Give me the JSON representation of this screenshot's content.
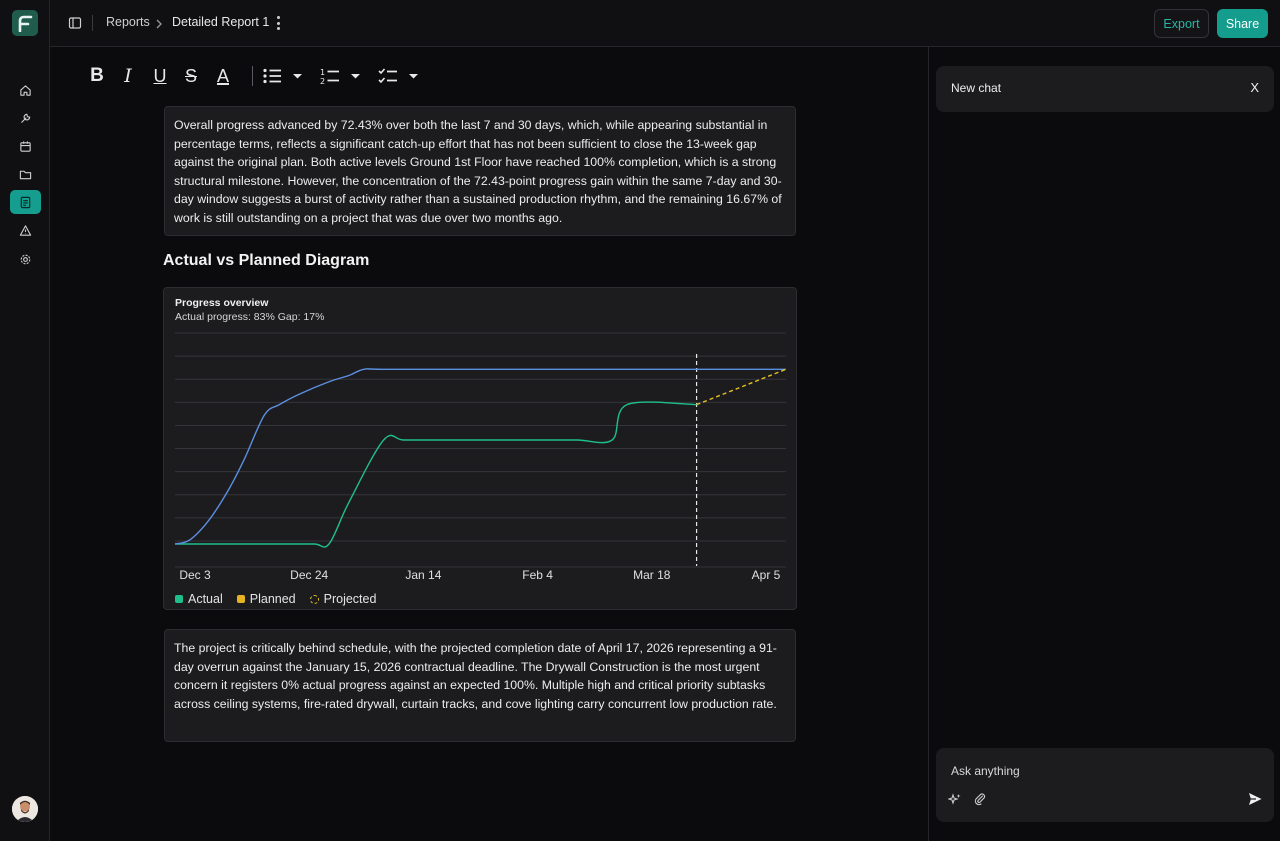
{
  "header": {
    "breadcrumb_root": "Reports",
    "breadcrumb_current": "Detailed Report 1",
    "export_label": "Export",
    "share_label": "Share"
  },
  "toolbar": {
    "bold": "B",
    "italic": "I",
    "underline": "U",
    "strike": "S",
    "text_color": "A"
  },
  "document": {
    "summary_paragraph": "Overall progress advanced by 72.43% over both the last 7 and 30 days, which, while appearing substantial in percentage terms, reflects a significant catch-up effort that has not been sufficient to close the 13-week gap against the original plan. Both active levels Ground 1st Floor have reached 100% completion, which is a strong structural milestone. However, the concentration of the 72.43-point progress gain within the same 7-day and 30-day window suggests a burst of activity rather than a sustained production rhythm, and the remaining 16.67% of work is still outstanding on a project that was due over two months ago.",
    "section_title": "Actual vs Planned Diagram",
    "bottom_paragraph": "The project is critically behind schedule, with the projected completion date of April 17, 2026 representing a 91-day overrun against the January 15, 2026 contractual deadline. The Drywall Construction is the most urgent concern it registers 0% actual progress against an expected 100%. Multiple high and critical priority subtasks across ceiling systems, fire-rated drywall, curtain tracks, and cove lighting carry concurrent low production rate."
  },
  "chart_data": {
    "type": "line",
    "title": "Progress overview",
    "subtitle": "Actual progress: 83%   Gap: 17%",
    "x_tick_labels": [
      "Dec 3",
      "Dec 24",
      "Jan 14",
      "Feb 4",
      "Mar 18",
      "Apr 5"
    ],
    "ylim": [
      0,
      100
    ],
    "grid": true,
    "legend_position": "bottom-left",
    "today_marker": "Mar 18",
    "series": [
      {
        "name": "Actual",
        "color": "#1fbf8a",
        "points": [
          [
            "Dec 3",
            0
          ],
          [
            "Dec 10",
            0
          ],
          [
            "Dec 17",
            0
          ],
          [
            "Dec 24",
            0
          ],
          [
            "Dec 31",
            0
          ],
          [
            "Jan 3",
            0
          ],
          [
            "Jan 7",
            20
          ],
          [
            "Jan 14",
            50
          ],
          [
            "Jan 18",
            50
          ],
          [
            "Jan 25",
            50
          ],
          [
            "Feb 1",
            50
          ],
          [
            "Feb 8",
            50
          ],
          [
            "Feb 15",
            50
          ],
          [
            "Feb 22",
            50
          ],
          [
            "Mar 1",
            50
          ],
          [
            "Mar 4",
            67
          ],
          [
            "Mar 18",
            67
          ]
        ]
      },
      {
        "name": "Planned",
        "color": "#5b8fe0",
        "points": [
          [
            "Dec 3",
            0
          ],
          [
            "Dec 6",
            2
          ],
          [
            "Dec 10",
            12
          ],
          [
            "Dec 14",
            27
          ],
          [
            "Dec 17",
            41
          ],
          [
            "Dec 21",
            62
          ],
          [
            "Dec 24",
            67
          ],
          [
            "Dec 28",
            72
          ],
          [
            "Jan 3",
            78
          ],
          [
            "Jan 7",
            81
          ],
          [
            "Jan 10",
            84
          ],
          [
            "Jan 14",
            84
          ],
          [
            "Feb 4",
            84
          ],
          [
            "Mar 18",
            84
          ],
          [
            "Apr 5",
            84
          ]
        ]
      },
      {
        "name": "Projected",
        "color": "#e6c21f",
        "dashed": true,
        "points": [
          [
            "Mar 18",
            67
          ],
          [
            "Apr 5",
            84
          ]
        ]
      }
    ],
    "legend": [
      {
        "name": "Actual",
        "color": "#1fbf8a"
      },
      {
        "name": "Planned",
        "color": "#e6b422"
      },
      {
        "name": "Projected",
        "color": "#e6c21f"
      }
    ]
  },
  "chat": {
    "title": "New chat",
    "close_label": "X",
    "input_placeholder": "Ask anything"
  },
  "icons": {
    "logo": "app-logo-icon",
    "nav": [
      "home-icon",
      "wrench-icon",
      "calendar-icon",
      "folder-icon",
      "report-icon",
      "warning-icon",
      "settings-icon"
    ],
    "active_nav": "report-icon"
  },
  "colors": {
    "accent": "#149c8d",
    "background": "#0b0b0d",
    "card": "#1c1c1f"
  }
}
